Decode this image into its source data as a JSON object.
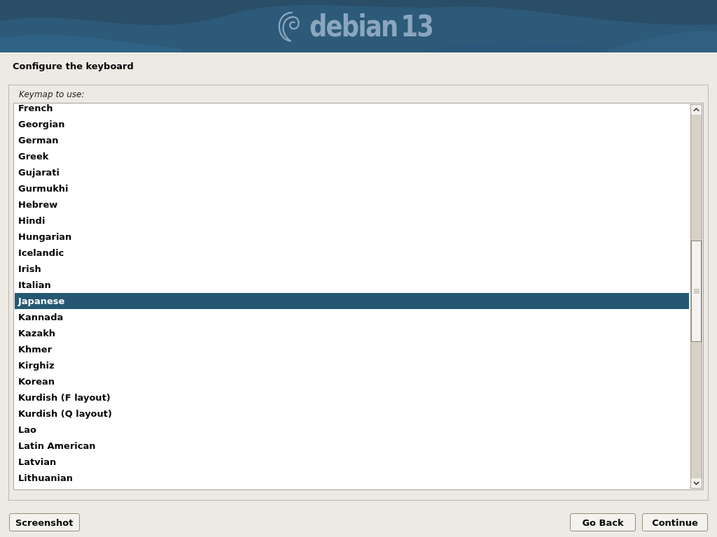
{
  "header": {
    "brand": "debian",
    "version": "13"
  },
  "page_title": "Configure the keyboard",
  "keymap": {
    "label": "Keymap to use:",
    "items": [
      {
        "label": "French",
        "selected": false
      },
      {
        "label": "Georgian",
        "selected": false
      },
      {
        "label": "German",
        "selected": false
      },
      {
        "label": "Greek",
        "selected": false
      },
      {
        "label": "Gujarati",
        "selected": false
      },
      {
        "label": "Gurmukhi",
        "selected": false
      },
      {
        "label": "Hebrew",
        "selected": false
      },
      {
        "label": "Hindi",
        "selected": false
      },
      {
        "label": "Hungarian",
        "selected": false
      },
      {
        "label": "Icelandic",
        "selected": false
      },
      {
        "label": "Irish",
        "selected": false
      },
      {
        "label": "Italian",
        "selected": false
      },
      {
        "label": "Japanese",
        "selected": true
      },
      {
        "label": "Kannada",
        "selected": false
      },
      {
        "label": "Kazakh",
        "selected": false
      },
      {
        "label": "Khmer",
        "selected": false
      },
      {
        "label": "Kirghiz",
        "selected": false
      },
      {
        "label": "Korean",
        "selected": false
      },
      {
        "label": "Kurdish (F layout)",
        "selected": false
      },
      {
        "label": "Kurdish (Q layout)",
        "selected": false
      },
      {
        "label": "Lao",
        "selected": false
      },
      {
        "label": "Latin American",
        "selected": false
      },
      {
        "label": "Latvian",
        "selected": false
      },
      {
        "label": "Lithuanian",
        "selected": false
      }
    ]
  },
  "buttons": {
    "left": [
      "Screenshot"
    ],
    "right": [
      "Go Back",
      "Continue"
    ]
  }
}
